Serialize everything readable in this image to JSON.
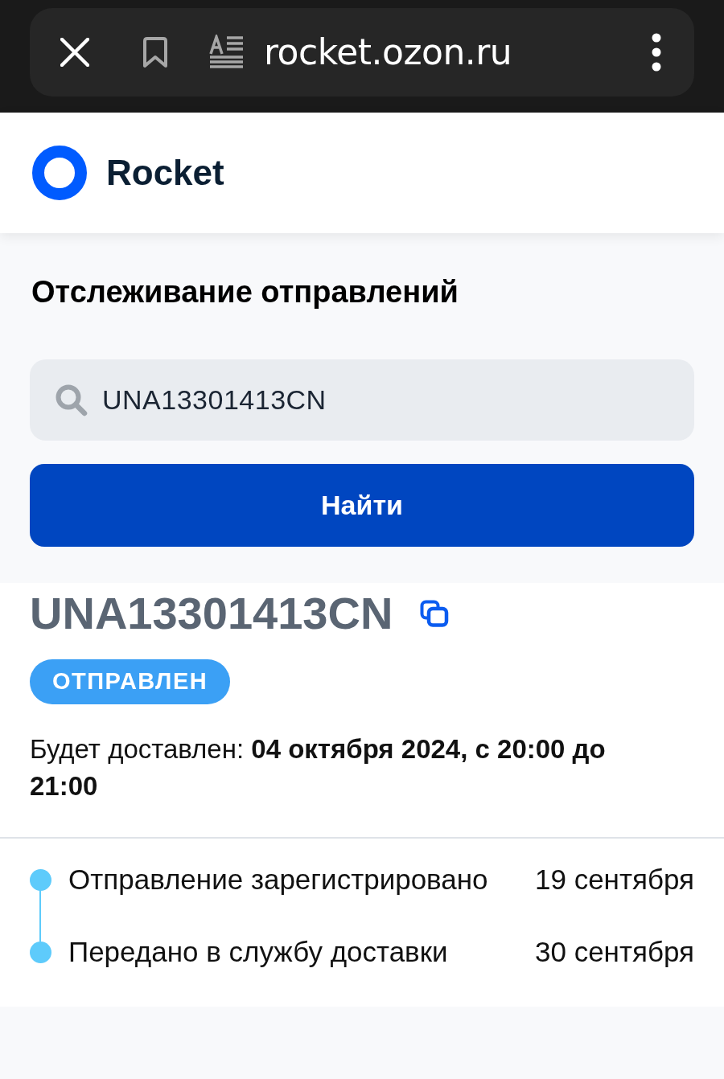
{
  "browser_bar": {
    "url": "rocket.ozon.ru"
  },
  "header": {
    "brand": "Rocket"
  },
  "search": {
    "title": "Отслеживание отправлений",
    "field": {
      "value": "UNA13301413CN"
    },
    "button": "Найти"
  },
  "shipment": {
    "tracking_number": "UNA13301413CN",
    "status": "ОТПРАВЛЕН",
    "delivery": "Будет доставлен: **04 октября 2024, с 20:00 до 21:00**"
  },
  "timeline": [
    {
      "event": "Отправление зарегистрировано",
      "date": "19 сентября"
    },
    {
      "event": "Передано в службу доставки",
      "date": "30 сентября"
    }
  ]
}
